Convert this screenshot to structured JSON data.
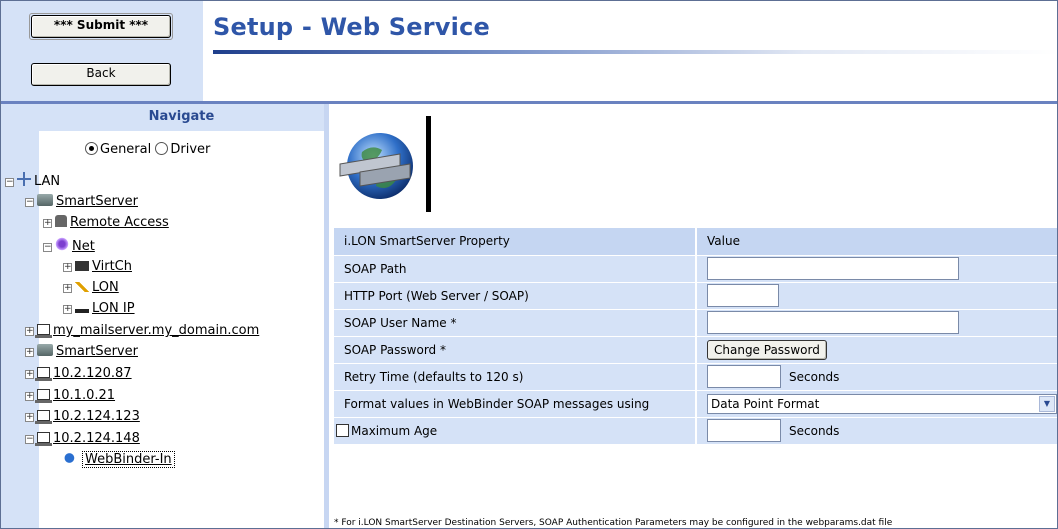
{
  "header": {
    "submit_label": "*** Submit ***",
    "back_label": "Back",
    "title": "Setup - Web Service"
  },
  "nav": {
    "title": "Navigate",
    "mode_options": [
      "General",
      "Driver"
    ],
    "mode_selected": "General",
    "tree": [
      {
        "label": "LAN",
        "icon": "lan-icon",
        "toggle": "−"
      },
      {
        "label": "SmartServer",
        "icon": "server-icon",
        "toggle": "−"
      },
      {
        "label": "Remote Access",
        "icon": "phone-icon",
        "toggle": "+"
      },
      {
        "label": "Net",
        "icon": "net-icon",
        "toggle": "−"
      },
      {
        "label": "VirtCh",
        "icon": "chip-icon",
        "toggle": "+"
      },
      {
        "label": "LON",
        "icon": "lon-icon",
        "toggle": "+"
      },
      {
        "label": "LON IP",
        "icon": "ip-icon",
        "toggle": "+"
      },
      {
        "label": "my_mailserver.my_domain.com",
        "icon": "pc-icon",
        "toggle": "+"
      },
      {
        "label": "SmartServer",
        "icon": "server-icon",
        "toggle": "+"
      },
      {
        "label": "10.2.120.87",
        "icon": "pc-icon",
        "toggle": "+"
      },
      {
        "label": "10.1.0.21",
        "icon": "pc-icon",
        "toggle": "+"
      },
      {
        "label": "10.2.124.123",
        "icon": "pc-icon",
        "toggle": "+"
      },
      {
        "label": "10.2.124.148",
        "icon": "pc-icon",
        "toggle": "−"
      },
      {
        "label": "WebBinder-In",
        "icon": "webbinder-icon",
        "toggle": ""
      }
    ]
  },
  "table": {
    "header_property": "i.LON SmartServer Property",
    "header_value": "Value",
    "rows": {
      "soap_path": "SOAP Path",
      "http_port": "HTTP Port (Web Server / SOAP)",
      "soap_user": "SOAP User Name *",
      "soap_password": "SOAP Password *",
      "change_password_label": "Change Password",
      "retry_time": "Retry Time (defaults to 120 s)",
      "seconds_unit": "Seconds",
      "format_values": "Format values in WebBinder SOAP messages using",
      "format_selected": "Data Point Format",
      "max_age": "Maximum Age"
    }
  },
  "footnote": "* For i.LON SmartServer Destination Servers, SOAP Authentication Parameters may be configured in the webparams.dat file"
}
